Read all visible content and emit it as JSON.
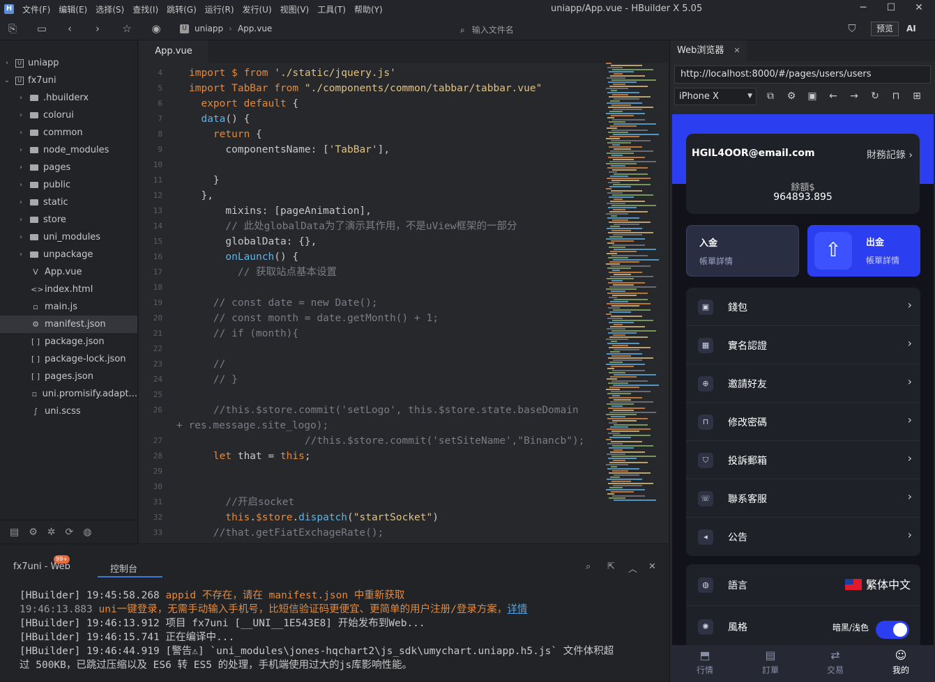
{
  "menubar": {
    "items": [
      "文件(F)",
      "编辑(E)",
      "选择(S)",
      "查找(I)",
      "跳转(G)",
      "运行(R)",
      "发行(U)",
      "视图(V)",
      "工具(T)",
      "帮助(Y)"
    ],
    "window_title": "uniapp/App.vue - HBuilder X 5.05"
  },
  "toolbar": {
    "crumb_project": "uniapp",
    "crumb_file": "App.vue",
    "file_input_placeholder": "输入文件名",
    "preview_label": "预览",
    "ai_label": "AI"
  },
  "sidebar": {
    "items": [
      {
        "label": "uniapp",
        "type": "project",
        "expanded": false
      },
      {
        "label": "fx7uni",
        "type": "project",
        "expanded": true
      },
      {
        "label": ".hbuilderx",
        "type": "folder"
      },
      {
        "label": "colorui",
        "type": "folder"
      },
      {
        "label": "common",
        "type": "folder"
      },
      {
        "label": "node_modules",
        "type": "folder"
      },
      {
        "label": "pages",
        "type": "folder"
      },
      {
        "label": "public",
        "type": "folder"
      },
      {
        "label": "static",
        "type": "folder"
      },
      {
        "label": "store",
        "type": "folder"
      },
      {
        "label": "uni_modules",
        "type": "folder"
      },
      {
        "label": "unpackage",
        "type": "folder"
      },
      {
        "label": "App.vue",
        "type": "vue"
      },
      {
        "label": "index.html",
        "type": "html"
      },
      {
        "label": "main.js",
        "type": "js"
      },
      {
        "label": "manifest.json",
        "type": "manifest",
        "selected": true
      },
      {
        "label": "package.json",
        "type": "json"
      },
      {
        "label": "package-lock.json",
        "type": "json"
      },
      {
        "label": "pages.json",
        "type": "json"
      },
      {
        "label": "uni.promisify.adapt...",
        "type": "js"
      },
      {
        "label": "uni.scss",
        "type": "scss"
      }
    ]
  },
  "editor": {
    "tab": "App.vue",
    "lines": [
      {
        "n": "4",
        "tokens": [
          [
            "k",
            "import "
          ],
          [
            "k",
            "$ "
          ],
          [
            "k",
            "from "
          ],
          [
            "s",
            "'./static/jquery.js'"
          ]
        ]
      },
      {
        "n": "5",
        "tokens": [
          [
            "k",
            "import "
          ],
          [
            "k",
            "TabBar "
          ],
          [
            "k",
            "from "
          ],
          [
            "s",
            "\"./components/common/tabbar/tabbar.vue\""
          ]
        ]
      },
      {
        "n": "6",
        "tokens": [
          [
            "p",
            "  "
          ],
          [
            "k",
            "export default "
          ],
          [
            "p",
            "{"
          ]
        ]
      },
      {
        "n": "7",
        "tokens": [
          [
            "p",
            "  "
          ],
          [
            "f",
            "data"
          ],
          [
            "p",
            "() {"
          ]
        ]
      },
      {
        "n": "8",
        "tokens": [
          [
            "p",
            "    "
          ],
          [
            "k",
            "return "
          ],
          [
            "p",
            "{"
          ]
        ]
      },
      {
        "n": "9",
        "tokens": [
          [
            "p",
            "      componentsName: ["
          ],
          [
            "s",
            "'TabBar'"
          ],
          [
            "p",
            "],"
          ]
        ]
      },
      {
        "n": "10",
        "tokens": []
      },
      {
        "n": "11",
        "tokens": [
          [
            "p",
            "    }"
          ]
        ]
      },
      {
        "n": "12",
        "tokens": [
          [
            "p",
            "  },"
          ]
        ]
      },
      {
        "n": "13",
        "tokens": [
          [
            "p",
            "      mixins: [pageAnimation],"
          ]
        ]
      },
      {
        "n": "14",
        "tokens": [
          [
            "c",
            "      // 此处globalData为了演示其作用，不是uView框架的一部分"
          ]
        ]
      },
      {
        "n": "15",
        "tokens": [
          [
            "p",
            "      globalData: {},"
          ]
        ]
      },
      {
        "n": "16",
        "tokens": [
          [
            "f",
            "      onLaunch"
          ],
          [
            "p",
            "() {"
          ]
        ]
      },
      {
        "n": "17",
        "tokens": [
          [
            "c",
            "        // 获取站点基本设置"
          ]
        ]
      },
      {
        "n": "18",
        "tokens": []
      },
      {
        "n": "19",
        "tokens": [
          [
            "c",
            "    // const date = new Date();"
          ]
        ]
      },
      {
        "n": "20",
        "tokens": [
          [
            "c",
            "    // const month = date.getMonth() + 1;"
          ]
        ]
      },
      {
        "n": "21",
        "tokens": [
          [
            "c",
            "    // if (month){"
          ]
        ]
      },
      {
        "n": "22",
        "tokens": []
      },
      {
        "n": "23",
        "tokens": [
          [
            "c",
            "    //"
          ]
        ]
      },
      {
        "n": "24",
        "tokens": [
          [
            "c",
            "    // }"
          ]
        ]
      },
      {
        "n": "25",
        "tokens": []
      },
      {
        "n": "26",
        "tokens": [
          [
            "c",
            "    //this.$store.commit('setLogo', this.$store.state.baseDomain"
          ]
        ]
      },
      {
        "n": "",
        "tokens": [
          [
            "c",
            "+ res.message.site_logo);"
          ]
        ]
      },
      {
        "n": "27",
        "tokens": [
          [
            "c",
            "                   //this.$store.commit('setSiteName',\"Binancb\");"
          ]
        ]
      },
      {
        "n": "28",
        "tokens": [
          [
            "k",
            "    let "
          ],
          [
            "p",
            "that = "
          ],
          [
            "k",
            "this"
          ],
          [
            "p",
            ";"
          ]
        ]
      },
      {
        "n": "29",
        "tokens": []
      },
      {
        "n": "30",
        "tokens": []
      },
      {
        "n": "31",
        "tokens": [
          [
            "c",
            "      //开启socket"
          ]
        ]
      },
      {
        "n": "32",
        "tokens": [
          [
            "k",
            "      this"
          ],
          [
            "p",
            "."
          ],
          [
            "k",
            "$store"
          ],
          [
            "p",
            "."
          ],
          [
            "f",
            "dispatch"
          ],
          [
            "p",
            "("
          ],
          [
            "s",
            "\"startSocket\""
          ],
          [
            "p",
            ")"
          ]
        ]
      },
      {
        "n": "33",
        "tokens": [
          [
            "c",
            "    //that.getFiatExchageRate();"
          ]
        ]
      }
    ]
  },
  "console": {
    "tab_project": "fx7uni - Web",
    "badge": "99+",
    "tab_console": "控制台",
    "logs": [
      [
        [
          "p",
          "[HBuilder] 19:45:58.268 "
        ],
        [
          "o",
          "appid 不存在，请在 manifest.json 中重新获取"
        ]
      ],
      [
        [
          "g",
          "19:46:13.883 "
        ],
        [
          "o",
          "uni一键登录，无需手动输入手机号，比短信验证码更便宜、更简单的用户注册/登录方案，"
        ],
        [
          "lk",
          "详情"
        ]
      ],
      [
        [
          "p",
          "[HBuilder] 19:46:13.912 项目 fx7uni [__UNI__1E543E8] 开始发布到Web..."
        ]
      ],
      [
        [
          "p",
          "[HBuilder] 19:46:15.741 正在编译中..."
        ]
      ],
      [
        [
          "p",
          "[HBuilder] 19:46:44.919 [警告⚠] `uni_modules\\jones-hqchart2\\js_sdk\\umychart.uniapp.h5.js` 文件体积超"
        ]
      ],
      [
        [
          "p",
          "过 500KB，已跳过压缩以及 ES6 转 ES5 的处理，手机端使用过大的js库影响性能。"
        ]
      ]
    ]
  },
  "browser": {
    "tab": "Web浏览器",
    "url": "http://localhost:8000/#/pages/users/users",
    "device": "iPhone X",
    "app": {
      "email": "HGIL4OOR@email.com",
      "record": "財務記錄",
      "balance_label": "餘額$",
      "balance": "964893.895",
      "deposit_title": "入金",
      "deposit_sub": "帳單詳情",
      "withdraw_title": "出金",
      "withdraw_sub": "帳單詳情",
      "menu": [
        "錢包",
        "實名認證",
        "邀請好友",
        "修改密碼",
        "投訴郵箱",
        "聯系客服",
        "公告"
      ],
      "language_label": "語言",
      "language_value": "繁体中文",
      "style_label": "風格",
      "style_value": "暗黑/浅色",
      "tabs": [
        "行情",
        "訂單",
        "交易",
        "我的"
      ]
    }
  }
}
